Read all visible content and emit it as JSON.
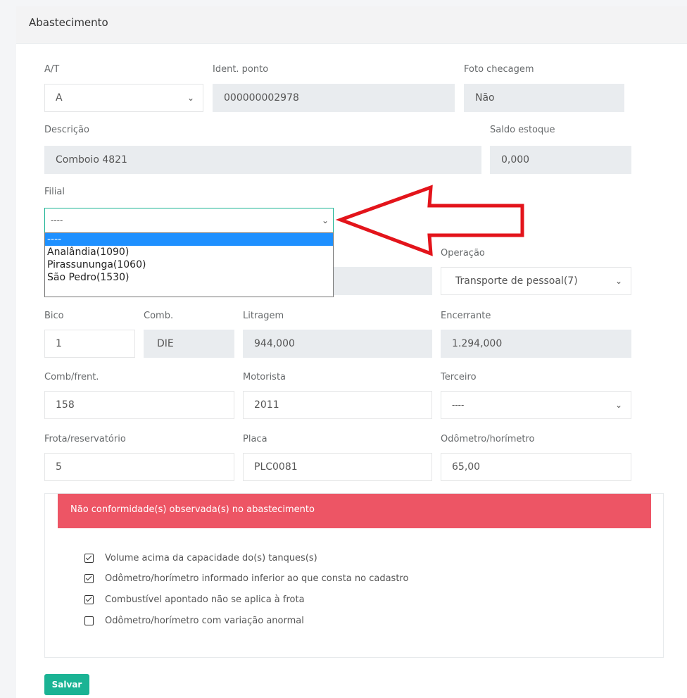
{
  "header": {
    "title": "Abastecimento"
  },
  "form": {
    "at": {
      "label": "A/T",
      "value": "A"
    },
    "ident_ponto": {
      "label": "Ident. ponto",
      "value": "000000002978"
    },
    "foto_checagem": {
      "label": "Foto checagem",
      "value": "Não"
    },
    "descricao": {
      "label": "Descrição",
      "value": "Comboio 4821"
    },
    "saldo_estoque": {
      "label": "Saldo estoque",
      "value": "0,000"
    },
    "filial": {
      "label": "Filial",
      "value": "----",
      "options": [
        "----",
        "Analândia(1090)",
        "Pirassununga(1060)",
        "São Pedro(1530)"
      ]
    },
    "operacao": {
      "label": "Operação",
      "value": "Transporte de pessoal(7)"
    },
    "bico": {
      "label": "Bico",
      "value": "1"
    },
    "comb": {
      "label": "Comb.",
      "value": "DIE"
    },
    "litragem": {
      "label": "Litragem",
      "value": "944,000"
    },
    "encerrante": {
      "label": "Encerrante",
      "value": "1.294,000"
    },
    "comb_frent": {
      "label": "Comb/frent.",
      "value": "158"
    },
    "motorista": {
      "label": "Motorista",
      "value": "2011"
    },
    "terceiro": {
      "label": "Terceiro",
      "value": "----"
    },
    "frota": {
      "label": "Frota/reservatório",
      "value": "5"
    },
    "placa": {
      "label": "Placa",
      "value": "PLC0081"
    },
    "odometro": {
      "label": "Odômetro/horímetro",
      "value": "65,00"
    }
  },
  "nonconformity": {
    "title": "Não conformidade(s) observada(s) no abastecimento",
    "items": [
      {
        "label": "Volume acima da capacidade do(s) tanques(s)",
        "checked": true
      },
      {
        "label": "Odômetro/horímetro informado inferior ao que consta no cadastro",
        "checked": true
      },
      {
        "label": "Combustível apontado não se aplica à frota",
        "checked": true
      },
      {
        "label": "Odômetro/horímetro com variação anormal",
        "checked": false
      }
    ]
  },
  "actions": {
    "save_label": "Salvar"
  },
  "colors": {
    "accent": "#1ab394",
    "danger": "#ed5565",
    "annotation_arrow": "#e3141b"
  }
}
